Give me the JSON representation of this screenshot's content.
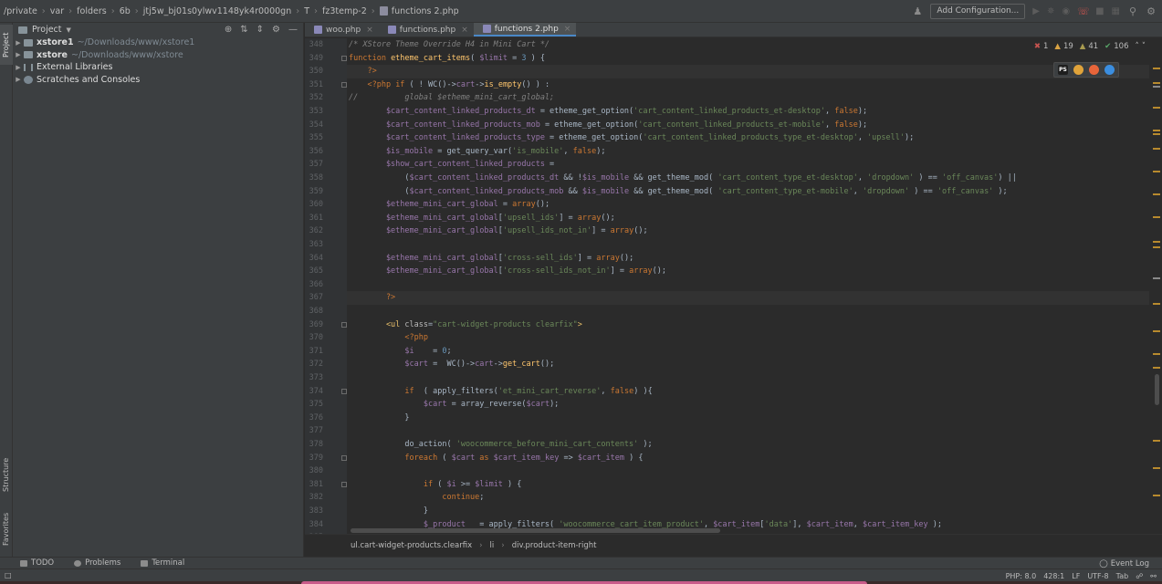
{
  "navbar": {
    "crumbs": [
      {
        "label": "private",
        "icon": ""
      },
      {
        "label": "var",
        "icon": ""
      },
      {
        "label": "folders",
        "icon": ""
      },
      {
        "label": "6b",
        "icon": ""
      },
      {
        "label": "jtj5w_bj01s0ylwv1148yk4r0000gn",
        "icon": ""
      },
      {
        "label": "T",
        "icon": ""
      },
      {
        "label": "fz3temp-2",
        "icon": ""
      },
      {
        "label": "functions 2.php",
        "icon": "php-file-icon"
      }
    ],
    "root_sep": "/",
    "add_configuration": "Add Configuration..."
  },
  "left_strip": {
    "project_tab": "Project",
    "structure_tab": "Structure",
    "favorites_tab": "Favorites"
  },
  "project": {
    "title": "Project",
    "tree": [
      {
        "name": "xstore1",
        "path": "~/Downloads/www/xstore1",
        "bold": true,
        "icon": "folder-icon"
      },
      {
        "name": "xstore",
        "path": "~/Downloads/www/xstore",
        "bold": true,
        "icon": "folder-icon"
      },
      {
        "name": "External Libraries",
        "path": "",
        "bold": false,
        "icon": "library-icon"
      },
      {
        "name": "Scratches and Consoles",
        "path": "",
        "bold": false,
        "icon": "scratch-icon"
      }
    ]
  },
  "editor_tabs": [
    {
      "label": "woo.php",
      "active": false
    },
    {
      "label": "functions.php",
      "active": false
    },
    {
      "label": "functions 2.php",
      "active": true
    }
  ],
  "inspections": {
    "errors": "1",
    "warnings": "19",
    "weak_warnings": "41",
    "typos": "106"
  },
  "browser_icons": [
    {
      "name": "phpstorm-icon",
      "label": "PS",
      "color": "#1e1e1e"
    },
    {
      "name": "chrome-icon",
      "label": "",
      "color": "#e0a33a"
    },
    {
      "name": "firefox-icon",
      "label": "",
      "color": "#e8653a"
    },
    {
      "name": "safari-icon",
      "label": "",
      "color": "#3b8ee0"
    }
  ],
  "code": {
    "first_line": 348,
    "lines": [
      [
        [
          "comment",
          "/* XStore Theme Override H4 in Mini Cart */"
        ]
      ],
      [
        [
          "kw",
          "function "
        ],
        [
          "fn",
          "etheme_cart_items"
        ],
        [
          "call",
          "( "
        ],
        [
          "var",
          "$limit"
        ],
        [
          "call",
          " = "
        ],
        [
          "num",
          "3"
        ],
        [
          "call",
          " ) {"
        ]
      ],
      [
        [
          "php",
          "    ?>"
        ]
      ],
      [
        [
          "php",
          "    <?php "
        ],
        [
          "kw",
          "if"
        ],
        [
          "call",
          " ( ! WC()->"
        ],
        [
          "var",
          "cart"
        ],
        [
          "call",
          "->"
        ],
        [
          "fn",
          "is_empty"
        ],
        [
          "call",
          "() ) :"
        ]
      ],
      [
        [
          "comment",
          "//          global $etheme_mini_cart_global;"
        ]
      ],
      [
        [
          "var",
          "        $cart_content_linked_products_dt"
        ],
        [
          "call",
          " = etheme_get_option("
        ],
        [
          "str",
          "'cart_content_linked_products_et-desktop'"
        ],
        [
          "call",
          ", "
        ],
        [
          "kw",
          "false"
        ],
        [
          "call",
          ");"
        ]
      ],
      [
        [
          "var",
          "        $cart_content_linked_products_mob"
        ],
        [
          "call",
          " = etheme_get_option("
        ],
        [
          "str",
          "'cart_content_linked_products_et-mobile'"
        ],
        [
          "call",
          ", "
        ],
        [
          "kw",
          "false"
        ],
        [
          "call",
          ");"
        ]
      ],
      [
        [
          "var",
          "        $cart_content_linked_products_type"
        ],
        [
          "call",
          " = etheme_get_option("
        ],
        [
          "str",
          "'cart_content_linked_products_type_et-desktop'"
        ],
        [
          "call",
          ", "
        ],
        [
          "str",
          "'upsell'"
        ],
        [
          "call",
          ");"
        ]
      ],
      [
        [
          "var",
          "        $is_mobile"
        ],
        [
          "call",
          " = get_query_var("
        ],
        [
          "str",
          "'is_mobile'"
        ],
        [
          "call",
          ", "
        ],
        [
          "kw",
          "false"
        ],
        [
          "call",
          ");"
        ]
      ],
      [
        [
          "var",
          "        $show_cart_content_linked_products"
        ],
        [
          "call",
          " ="
        ]
      ],
      [
        [
          "call",
          "            ("
        ],
        [
          "var",
          "$cart_content_linked_products_dt"
        ],
        [
          "call",
          " && !"
        ],
        [
          "var",
          "$is_mobile"
        ],
        [
          "call",
          " && get_theme_mod( "
        ],
        [
          "str",
          "'cart_content_type_et-desktop'"
        ],
        [
          "call",
          ", "
        ],
        [
          "str",
          "'dropdown'"
        ],
        [
          "call",
          " ) == "
        ],
        [
          "str",
          "'off_canvas'"
        ],
        [
          "call",
          ") ||"
        ]
      ],
      [
        [
          "call",
          "            ("
        ],
        [
          "var",
          "$cart_content_linked_products_mob"
        ],
        [
          "call",
          " && "
        ],
        [
          "var",
          "$is_mobile"
        ],
        [
          "call",
          " && get_theme_mod( "
        ],
        [
          "str",
          "'cart_content_type_et-mobile'"
        ],
        [
          "call",
          ", "
        ],
        [
          "str",
          "'dropdown'"
        ],
        [
          "call",
          " ) == "
        ],
        [
          "str",
          "'off_canvas'"
        ],
        [
          "call",
          " );"
        ]
      ],
      [
        [
          "var",
          "        $etheme_mini_cart_global"
        ],
        [
          "call",
          " = "
        ],
        [
          "kw",
          "array"
        ],
        [
          "call",
          "();"
        ]
      ],
      [
        [
          "var",
          "        $etheme_mini_cart_global"
        ],
        [
          "call",
          "["
        ],
        [
          "str",
          "'upsell_ids'"
        ],
        [
          "call",
          "] = "
        ],
        [
          "kw",
          "array"
        ],
        [
          "call",
          "();"
        ]
      ],
      [
        [
          "var",
          "        $etheme_mini_cart_global"
        ],
        [
          "call",
          "["
        ],
        [
          "str",
          "'upsell_ids_not_in'"
        ],
        [
          "call",
          "] = "
        ],
        [
          "kw",
          "array"
        ],
        [
          "call",
          "();"
        ]
      ],
      [
        [
          "call",
          ""
        ]
      ],
      [
        [
          "var",
          "        $etheme_mini_cart_global"
        ],
        [
          "call",
          "["
        ],
        [
          "str",
          "'cross-sell_ids'"
        ],
        [
          "call",
          "] = "
        ],
        [
          "kw",
          "array"
        ],
        [
          "call",
          "();"
        ]
      ],
      [
        [
          "var",
          "        $etheme_mini_cart_global"
        ],
        [
          "call",
          "["
        ],
        [
          "str",
          "'cross-sell_ids_not_in'"
        ],
        [
          "call",
          "] = "
        ],
        [
          "kw",
          "array"
        ],
        [
          "call",
          "();"
        ]
      ],
      [
        [
          "call",
          ""
        ]
      ],
      [
        [
          "php",
          "        ?>"
        ]
      ],
      [
        [
          "call",
          ""
        ]
      ],
      [
        [
          "tag",
          "        <ul "
        ],
        [
          "attr",
          "class"
        ],
        [
          "call",
          "="
        ],
        [
          "str",
          "\"cart-widget-products clearfix\""
        ],
        [
          "tag",
          ">"
        ]
      ],
      [
        [
          "php",
          "            <?php"
        ]
      ],
      [
        [
          "var",
          "            $i"
        ],
        [
          "call",
          "    = "
        ],
        [
          "num",
          "0"
        ],
        [
          "call",
          ";"
        ]
      ],
      [
        [
          "var",
          "            $cart"
        ],
        [
          "call",
          " =  WC()->"
        ],
        [
          "var",
          "cart"
        ],
        [
          "call",
          "->"
        ],
        [
          "fn",
          "get_cart"
        ],
        [
          "call",
          "();"
        ]
      ],
      [
        [
          "call",
          ""
        ]
      ],
      [
        [
          "kw",
          "            if"
        ],
        [
          "call",
          "  ( apply_filters("
        ],
        [
          "str",
          "'et_mini_cart_reverse'"
        ],
        [
          "call",
          ", "
        ],
        [
          "kw",
          "false"
        ],
        [
          "call",
          ") ){"
        ]
      ],
      [
        [
          "var",
          "                $cart"
        ],
        [
          "call",
          " = array_reverse("
        ],
        [
          "var",
          "$cart"
        ],
        [
          "call",
          ");"
        ]
      ],
      [
        [
          "call",
          "            }"
        ]
      ],
      [
        [
          "call",
          ""
        ]
      ],
      [
        [
          "call",
          "            do_action( "
        ],
        [
          "str",
          "'woocommerce_before_mini_cart_contents'"
        ],
        [
          "call",
          " );"
        ]
      ],
      [
        [
          "kw",
          "            foreach"
        ],
        [
          "call",
          " ( "
        ],
        [
          "var",
          "$cart"
        ],
        [
          "kw",
          " as "
        ],
        [
          "var",
          "$cart_item_key"
        ],
        [
          "call",
          " => "
        ],
        [
          "var",
          "$cart_item"
        ],
        [
          "call",
          " ) {"
        ]
      ],
      [
        [
          "call",
          ""
        ]
      ],
      [
        [
          "kw",
          "                if"
        ],
        [
          "call",
          " ( "
        ],
        [
          "var",
          "$i"
        ],
        [
          "call",
          " >= "
        ],
        [
          "var",
          "$limit"
        ],
        [
          "call",
          " ) {"
        ]
      ],
      [
        [
          "kw",
          "                    continue"
        ],
        [
          "call",
          ";"
        ]
      ],
      [
        [
          "call",
          "                }"
        ]
      ],
      [
        [
          "var",
          "                $_product"
        ],
        [
          "call",
          "   = apply_filters( "
        ],
        [
          "str",
          "'woocommerce_cart_item_product'"
        ],
        [
          "call",
          ", "
        ],
        [
          "var",
          "$cart_item"
        ],
        [
          "call",
          "["
        ],
        [
          "str",
          "'data'"
        ],
        [
          "call",
          "], "
        ],
        [
          "var",
          "$cart_item"
        ],
        [
          "call",
          ", "
        ],
        [
          "var",
          "$cart_item_key"
        ],
        [
          "call",
          " );"
        ]
      ],
      [
        [
          "call",
          ""
        ]
      ]
    ]
  },
  "code_crumbs": [
    "ul.cart-widget-products.clearfix",
    "li",
    "div.product-item-right"
  ],
  "toolwin": {
    "todo": "TODO",
    "problems": "Problems",
    "terminal": "Terminal",
    "event_log": "Event Log"
  },
  "status": {
    "php": "PHP: 8.0",
    "position": "428:1",
    "line_sep": "LF",
    "encoding": "UTF-8",
    "indent": "Tab"
  },
  "colors": {
    "accent": "#4a88c7",
    "error": "#c75450",
    "warning": "#d9a343",
    "ok": "#59a869"
  }
}
